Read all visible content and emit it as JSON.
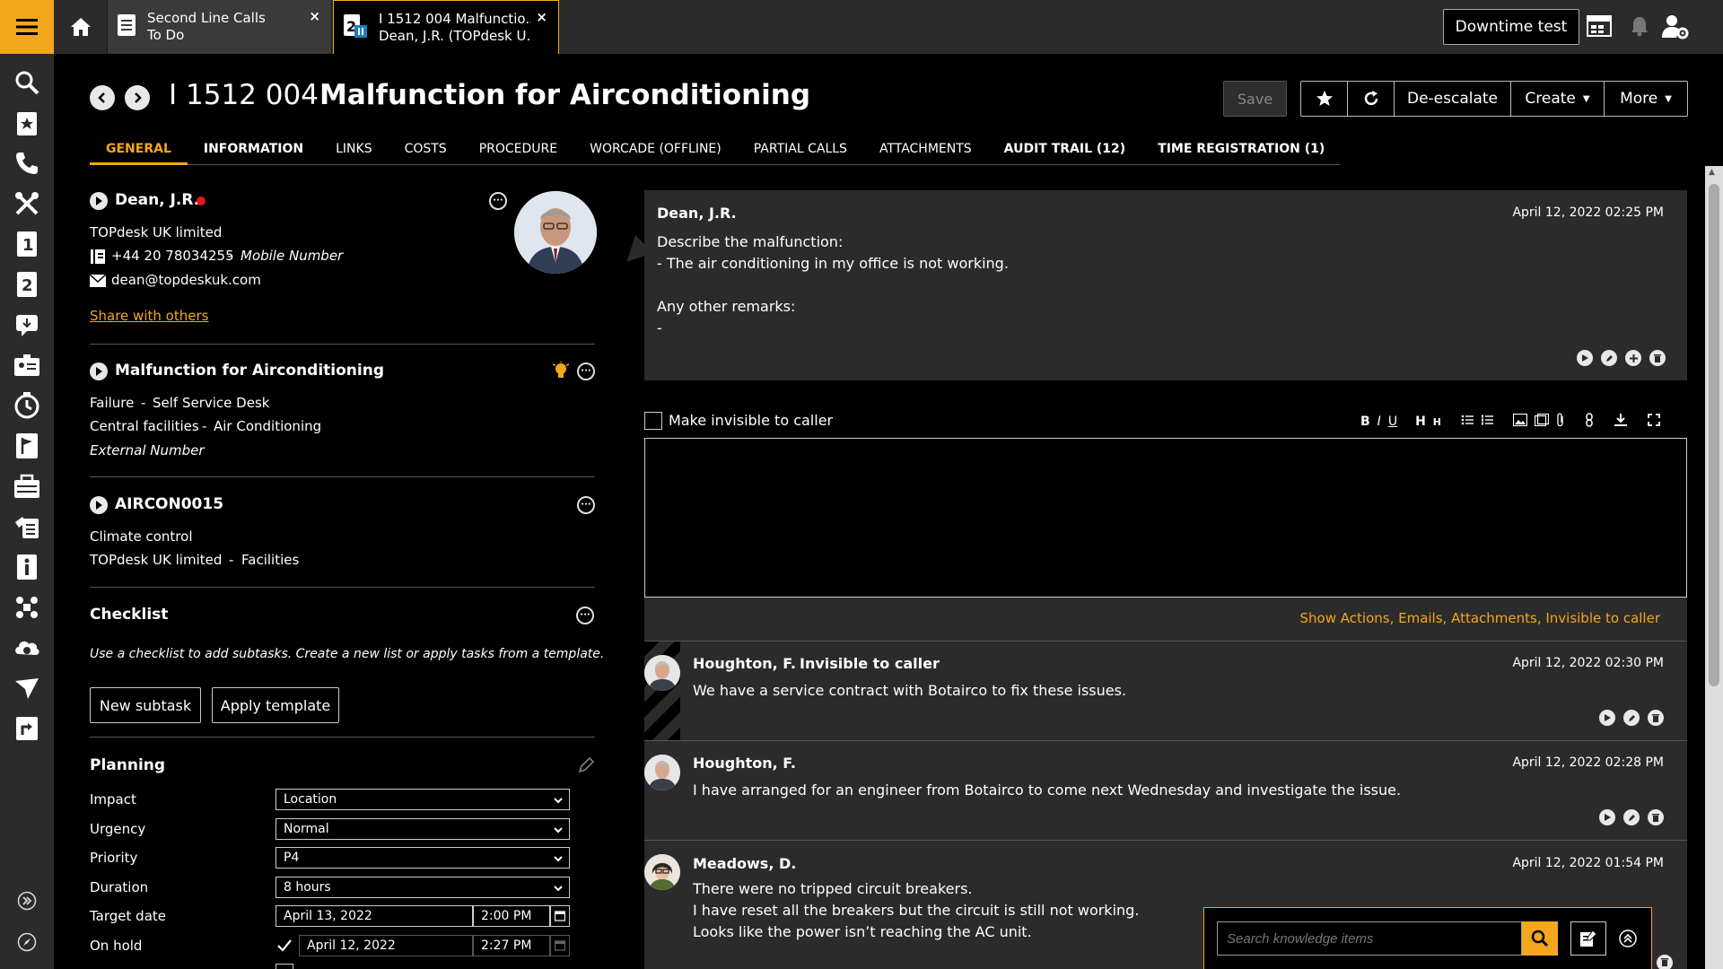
{
  "colors": {
    "accent": "#f3a71c",
    "danger": "#e0161b",
    "bg": "#000000",
    "panel": "#2b2b2b"
  },
  "topbar": {
    "tabs": [
      {
        "line1": "Second Line Calls",
        "line2": "To Do",
        "icon": "list-icon",
        "close": "×"
      },
      {
        "line1": "I 1512 004 Malfunctio...",
        "line2": "Dean, J.R. (TOPdesk U...",
        "icon": "second-line-paused-icon",
        "close": "×"
      }
    ],
    "downtime_label": "Downtime test"
  },
  "header": {
    "card_number": "I 1512 004",
    "title": "Malfunction for Airconditioning",
    "save_label": "Save",
    "deescalate_label": "De-escalate",
    "create_label": "Create",
    "more_label": "More"
  },
  "subtabs": [
    {
      "label": "GENERAL",
      "state": "active"
    },
    {
      "label": "INFORMATION",
      "state": "bold"
    },
    {
      "label": "LINKS",
      "state": "normal"
    },
    {
      "label": "COSTS",
      "state": "normal"
    },
    {
      "label": "PROCEDURE",
      "state": "normal"
    },
    {
      "label": "WORCADE (OFFLINE)",
      "state": "normal"
    },
    {
      "label": "PARTIAL CALLS",
      "state": "normal"
    },
    {
      "label": "ATTACHMENTS",
      "state": "normal"
    },
    {
      "label": "AUDIT TRAIL (12)",
      "state": "bold"
    },
    {
      "label": "TIME REGISTRATION (1)",
      "state": "bold"
    }
  ],
  "caller": {
    "name": "Dean, J.R.",
    "company": "TOPdesk UK limited",
    "phone": "+44 20 78034255",
    "phone_sep": "-",
    "phone_type": "Mobile Number",
    "email": "dean@topdeskuk.com",
    "share_label": "Share with others"
  },
  "call": {
    "title": "Malfunction for Airconditioning",
    "type": "Failure",
    "entry": "Self Service Desk",
    "category": "Central facilities",
    "subcategory": "Air Conditioning",
    "sep": "-",
    "external_number_label": "External Number"
  },
  "object": {
    "id": "AIRCON0015",
    "type": "Climate control",
    "company": "TOPdesk UK limited",
    "sep": "-",
    "location": "Facilities"
  },
  "checklist": {
    "title": "Checklist",
    "hint": "Use a checklist to add subtasks. Create a new list or apply tasks from a template.",
    "new_subtask_label": "New subtask",
    "apply_template_label": "Apply template"
  },
  "planning": {
    "title": "Planning",
    "fields": [
      {
        "label": "Impact",
        "value": "Location"
      },
      {
        "label": "Urgency",
        "value": "Normal"
      },
      {
        "label": "Priority",
        "value": "P4"
      },
      {
        "label": "Duration",
        "value": "8 hours"
      }
    ],
    "target_date_label": "Target date",
    "target_date": "April 13, 2022",
    "target_time": "2:00 PM",
    "on_hold_label": "On hold",
    "on_hold_checked": true,
    "on_hold_date": "April 12, 2022",
    "on_hold_time": "2:27 PM"
  },
  "request": {
    "author": "Dean, J.R.",
    "date": "April 12, 2022 02:25 PM",
    "lines": [
      "Describe the malfunction:",
      "- The air conditioning in my office is not working.",
      "",
      "Any other remarks:",
      "-"
    ]
  },
  "editor": {
    "invisible_label": "Make invisible to caller",
    "toolbar": [
      "B",
      "I",
      "U",
      "H",
      "H"
    ]
  },
  "filter_link": "Show Actions, Emails, Attachments, Invisible to caller",
  "actions": [
    {
      "author": "Houghton, F.",
      "flag": "Invisible to caller",
      "date": "April 12, 2022 02:30 PM",
      "lines": [
        "We have a service contract with Botairco to fix these issues."
      ]
    },
    {
      "author": "Houghton, F.",
      "flag": "",
      "date": "April 12, 2022 02:28 PM",
      "lines": [
        "I have arranged for an engineer from Botairco to come next Wednesday and investigate the issue."
      ]
    },
    {
      "author": "Meadows, D.",
      "flag": "",
      "date": "April 12, 2022 01:54 PM",
      "lines": [
        "There were no tripped circuit breakers.",
        "I have reset all the breakers but the circuit is still not working.",
        "Looks like the power isn’t reaching the AC unit."
      ]
    }
  ],
  "knowledge": {
    "placeholder": "Search knowledge items"
  }
}
